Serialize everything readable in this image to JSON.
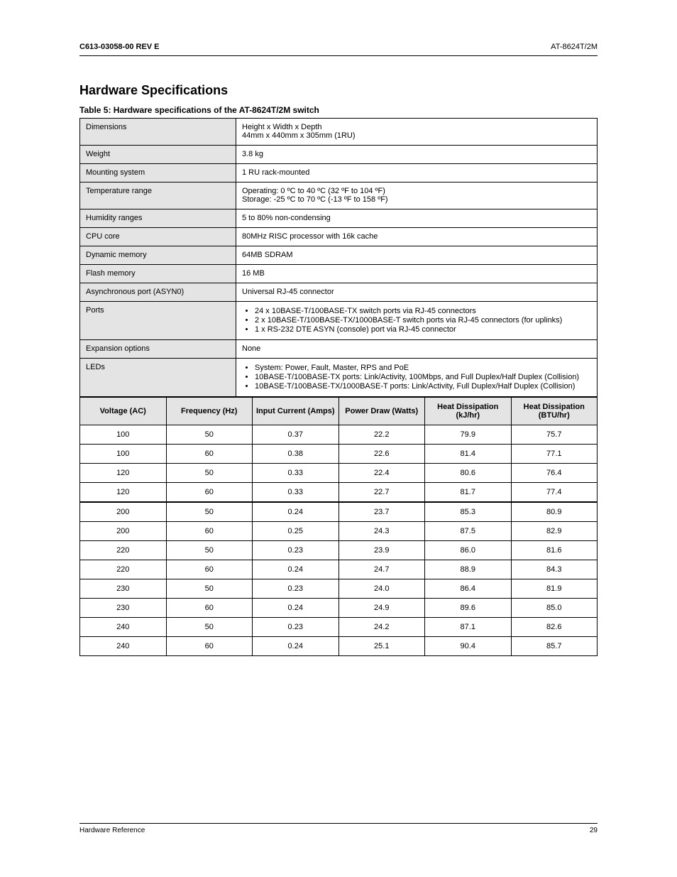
{
  "header": {
    "left": "C613-03058-00 REV E",
    "right": "AT-8624T/2M"
  },
  "section_title": "Hardware Specifications",
  "table_title": "Table 5: Hardware specifications of the AT-8624T/2M switch",
  "spec": {
    "dimensions": {
      "label": "Dimensions",
      "value_line1": "Height x Width x Depth",
      "value_line2": "44mm x 440mm x 305mm (1RU)"
    },
    "weight": {
      "label": "Weight",
      "value": "3.8 kg"
    },
    "mounting": {
      "label": "Mounting system",
      "value": "1 RU rack-mounted"
    },
    "temperature": {
      "label": "Temperature range",
      "value_line1": "Operating: 0 ºC to 40 ºC (32 ºF to 104 ºF)",
      "value_line2": "Storage: -25 ºC to 70 ºC (-13 ºF to 158 ºF)"
    },
    "humidity": {
      "label": "Humidity ranges",
      "value": "5 to 80% non-condensing"
    },
    "cpu": {
      "label": "CPU core",
      "value": "80MHz RISC processor with 16k cache"
    },
    "memory": {
      "label": "Dynamic memory",
      "value": "64MB SDRAM"
    },
    "flash": {
      "label": "Flash memory",
      "value": "16 MB"
    },
    "async": {
      "label": "Asynchronous port (ASYN0)",
      "value": "Universal RJ-45 connector"
    },
    "ports": {
      "label": "Ports",
      "items": [
        "24 x 10BASE-T/100BASE-TX switch ports via RJ-45 connectors",
        "2 x 10BASE-T/100BASE-TX/1000BASE-T switch ports via RJ-45 connectors (for uplinks)",
        "1 x RS-232 DTE ASYN (console) port via RJ-45 connector"
      ]
    },
    "expansion": {
      "label": "Expansion options",
      "value": "None"
    },
    "leds": {
      "label": "LEDs",
      "items": [
        "System: Power, Fault, Master, RPS and PoE",
        "10BASE-T/100BASE-TX ports: Link/Activity, 100Mbps, and Full Duplex/Half Duplex (Collision)",
        "10BASE-T/100BASE-TX/1000BASE-T ports: Link/Activity, Full Duplex/Half Duplex (Collision)"
      ]
    }
  },
  "rates_header": [
    "Voltage (AC)",
    "Frequency (Hz)",
    "Input Current (Amps)",
    "Power Draw (Watts)",
    "Heat Dissipation (kJ/hr)",
    "Heat Dissipation (BTU/hr)"
  ],
  "rates_rows": [
    [
      "100",
      "50",
      "0.37",
      "22.2",
      "79.9",
      "75.7"
    ],
    [
      "100",
      "60",
      "0.38",
      "22.6",
      "81.4",
      "77.1"
    ],
    [
      "120",
      "50",
      "0.33",
      "22.4",
      "80.6",
      "76.4"
    ],
    [
      "120",
      "60",
      "0.33",
      "22.7",
      "81.7",
      "77.4"
    ],
    [
      "200",
      "50",
      "0.24",
      "23.7",
      "85.3",
      "80.9"
    ],
    [
      "200",
      "60",
      "0.25",
      "24.3",
      "87.5",
      "82.9"
    ],
    [
      "220",
      "50",
      "0.23",
      "23.9",
      "86.0",
      "81.6"
    ],
    [
      "220",
      "60",
      "0.24",
      "24.7",
      "88.9",
      "84.3"
    ],
    [
      "230",
      "50",
      "0.23",
      "24.0",
      "86.4",
      "81.9"
    ],
    [
      "230",
      "60",
      "0.24",
      "24.9",
      "89.6",
      "85.0"
    ],
    [
      "240",
      "50",
      "0.23",
      "24.2",
      "87.1",
      "82.6"
    ],
    [
      "240",
      "60",
      "0.24",
      "25.1",
      "90.4",
      "85.7"
    ]
  ],
  "footer": {
    "left": "Hardware Reference",
    "right": "29"
  }
}
